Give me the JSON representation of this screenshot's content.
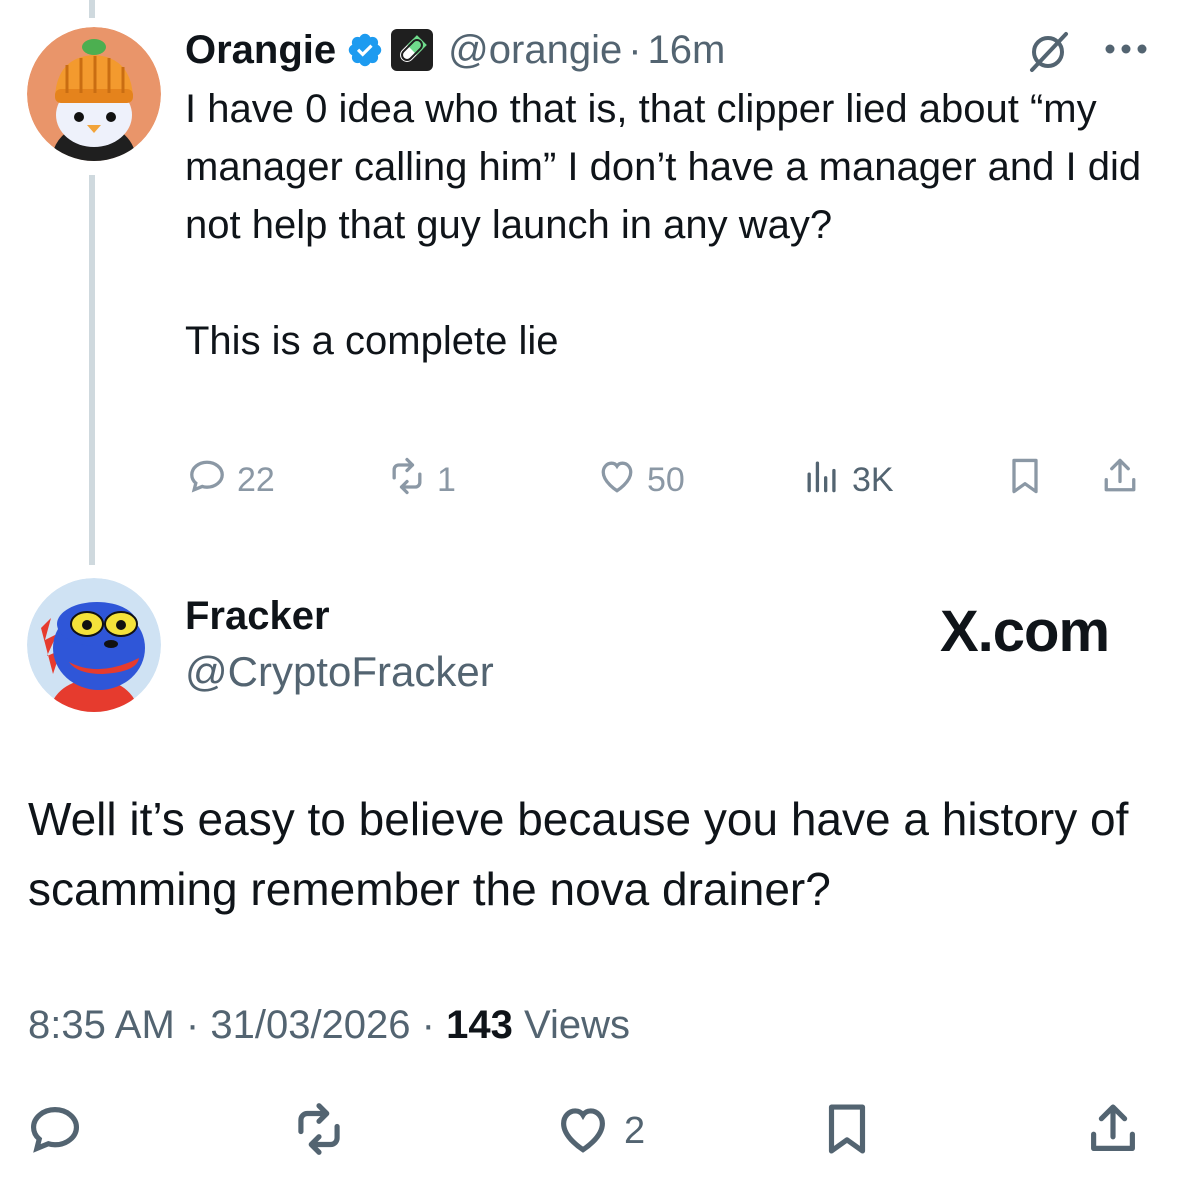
{
  "parent_tweet": {
    "display_name": "Orangie",
    "handle": "@orangie",
    "separator": "·",
    "time": "16m",
    "text": "I have 0 idea who that is, that clipper lied about “my manager calling him” I don’t have a manager and I did not help that guy launch in any way?\n\nThis is a complete lie",
    "stats": {
      "replies": "22",
      "reposts": "1",
      "likes": "50",
      "views": "3K"
    },
    "icons": [
      "verified-badge-icon",
      "pill-icon",
      "grok-icon",
      "more-icon",
      "reply-icon",
      "repost-icon",
      "like-icon",
      "views-icon",
      "bookmark-icon",
      "share-icon"
    ]
  },
  "main_tweet": {
    "display_name": "Fracker",
    "handle": "@CryptoFracker",
    "watermark": "X.com",
    "text": "Well it’s easy to believe because you have a history of scamming remember the nova drainer?",
    "time": "8:35 AM",
    "sep1": "·",
    "date": "31/03/2026",
    "sep2": "·",
    "views_count": "143",
    "views_label": "Views",
    "likes": "2",
    "icons": [
      "reply-icon",
      "repost-icon",
      "like-icon",
      "bookmark-icon",
      "share-icon"
    ]
  },
  "colors": {
    "verified": "#1d9bf0",
    "muted": "#536471",
    "thread_line": "#cfd9de"
  }
}
